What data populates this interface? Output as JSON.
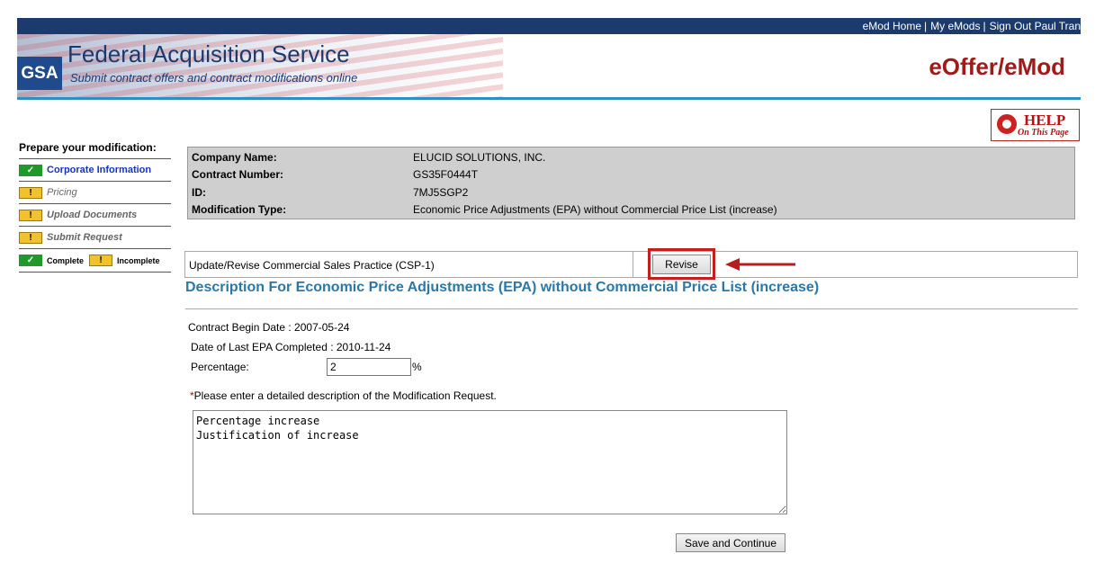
{
  "topnav": {
    "emod_home": "eMod Home",
    "my_emods": "My eMods",
    "sign_out": "Sign Out Paul Tran",
    "separator": "|"
  },
  "header": {
    "logo_text": "GSA",
    "title": "Federal Acquisition Service",
    "subtitle": "Submit contract offers and contract modifications online",
    "product": "eOffer/eMod"
  },
  "help": {
    "line1": "HELP",
    "line2": "On This Page"
  },
  "sidebar": {
    "heading": "Prepare your modification:",
    "items": [
      {
        "label": "Corporate Information",
        "status": "complete",
        "icon": "check-icon"
      },
      {
        "label": "Pricing",
        "status": "incomplete",
        "icon": "exclamation-icon"
      },
      {
        "label": "Upload Documents",
        "status": "incomplete",
        "icon": "exclamation-icon"
      },
      {
        "label": "Submit Request",
        "status": "incomplete",
        "icon": "exclamation-icon"
      }
    ],
    "legend": {
      "complete": "Complete",
      "incomplete": "Incomplete",
      "check_glyph": "✓",
      "warn_glyph": "!"
    }
  },
  "info": {
    "company_label": "Company Name:",
    "company_value": "ELUCID SOLUTIONS, INC.",
    "contract_label": "Contract Number:",
    "contract_value": "GS35F0444T",
    "id_label": "ID:",
    "id_value": "7MJ5SGP2",
    "modtype_label": "Modification Type:",
    "modtype_value": "Economic Price Adjustments (EPA) without Commercial Price List (increase)"
  },
  "csp": {
    "label": "Update/Revise Commercial Sales Practice (CSP-1)",
    "button": "Revise"
  },
  "description": {
    "title": "Description For Economic Price Adjustments (EPA) without Commercial Price List (increase)",
    "begin_date": "Contract Begin Date : 2007-05-24",
    "last_epa": "Date of Last EPA Completed : 2010-11-24",
    "percentage_label": "Percentage:",
    "percentage_value": "2",
    "percentage_unit": "%",
    "required_mark": "*",
    "required_note": "Please enter a detailed description of the Modification Request.",
    "text": "Percentage increase\nJustification of increase"
  },
  "actions": {
    "save": "Save and Continue"
  },
  "colors": {
    "topbar": "#1b3b6e",
    "accent_rule": "#2f8fc0",
    "product_red": "#a11a1a",
    "title_blue": "#2a78a8",
    "highlight": "#c41f1f",
    "complete_green": "#1f9a2a",
    "incomplete_yellow": "#f2c12e"
  }
}
